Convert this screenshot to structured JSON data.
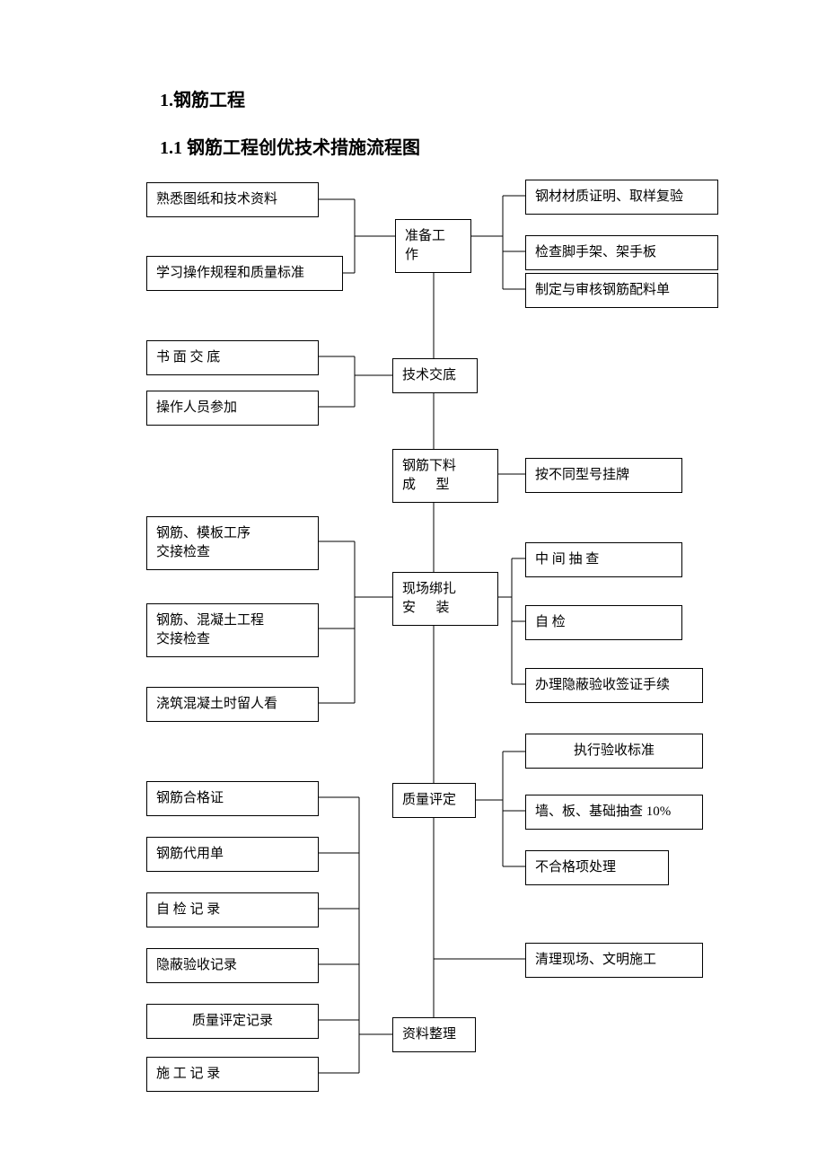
{
  "headings": {
    "h1": "1.钢筋工程",
    "h2": "1.1 钢筋工程创优技术措施流程图"
  },
  "center_nodes": {
    "prep": "准备工\n作",
    "tech_disclosure": "技术交底",
    "rebar_cut": "钢筋下料\n成      型",
    "site_binding": "现场绑扎\n安      装",
    "quality_eval": "质量评定",
    "doc_collate": "资料整理"
  },
  "left_nodes": {
    "familiar": "熟悉图纸和技术资料",
    "learn_spec": "学习操作规程和质量标准",
    "written": "书  面  交  底",
    "operators": "操作人员参加",
    "rebar_form": "钢筋、模板工序\n交接检查",
    "rebar_concrete": "钢筋、混凝土工程\n交接检查",
    "pour_watch": "浇筑混凝土时留人看",
    "cert": "钢筋合格证",
    "sub_slip": "钢筋代用单",
    "self_rec": "自  检  记  录",
    "hidden_rec": "隐蔽验收记录",
    "qual_rec": "质量评定记录",
    "const_rec": "施  工  记  录"
  },
  "right_nodes": {
    "material_cert": "钢材材质证明、取样复验",
    "scaffold": "检查脚手架、架手板",
    "make_check": "制定与审核钢筋配料单",
    "hang_tag": "按不同型号挂牌",
    "mid_check": "中  间  抽  查",
    "self_check": "自          检",
    "hidden_sign": "办理隐蔽验收签证手续",
    "exec_std": "执行验收标准",
    "wall_slab": "墙、板、基础抽查 10%",
    "fail_handle": "不合格项处理",
    "clean_site": "清理现场、文明施工"
  }
}
